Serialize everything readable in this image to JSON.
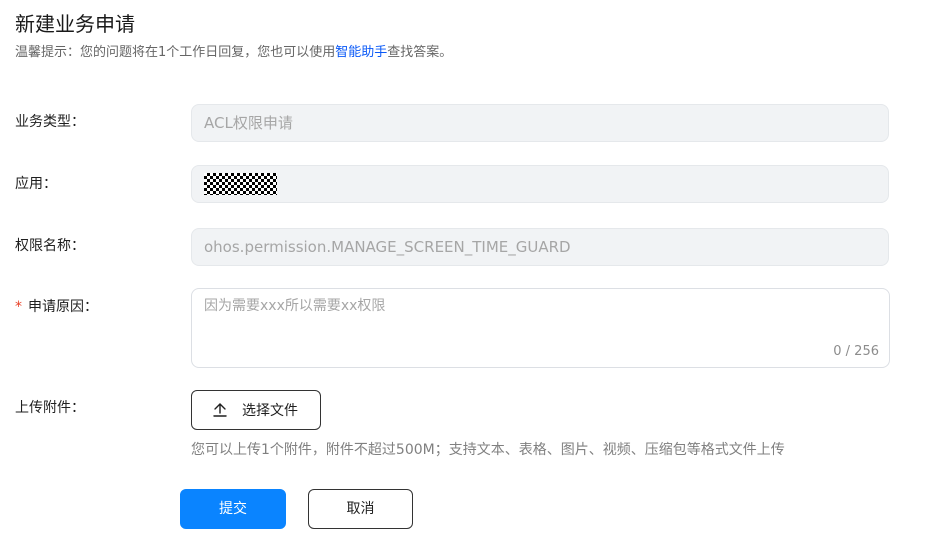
{
  "header": {
    "title": "新建业务申请",
    "tip_prefix": "温馨提示：您的问题将在1个工作日回复，您也可以使用",
    "tip_link": "智能助手",
    "tip_suffix": "查找答案。"
  },
  "form": {
    "business_type": {
      "label": "业务类型：",
      "value": "ACL权限申请"
    },
    "application": {
      "label": "应用："
    },
    "permission_name": {
      "label": "权限名称：",
      "value": "ohos.permission.MANAGE_SCREEN_TIME_GUARD"
    },
    "reason": {
      "required_mark": "*",
      "label": "申请原因：",
      "placeholder": "因为需要xxx所以需要xx权限",
      "counter": "0 / 256"
    },
    "attachment": {
      "label": "上传附件：",
      "button_label": "选择文件",
      "upload_icon": "upload-icon",
      "hint": "您可以上传1个附件，附件不超过500M；支持文本、表格、图片、视频、压缩包等格式文件上传"
    }
  },
  "actions": {
    "submit_label": "提交",
    "cancel_label": "取消"
  },
  "colors": {
    "accent": "#0a84ff",
    "link": "#0a59f7",
    "required": "#e84026"
  }
}
